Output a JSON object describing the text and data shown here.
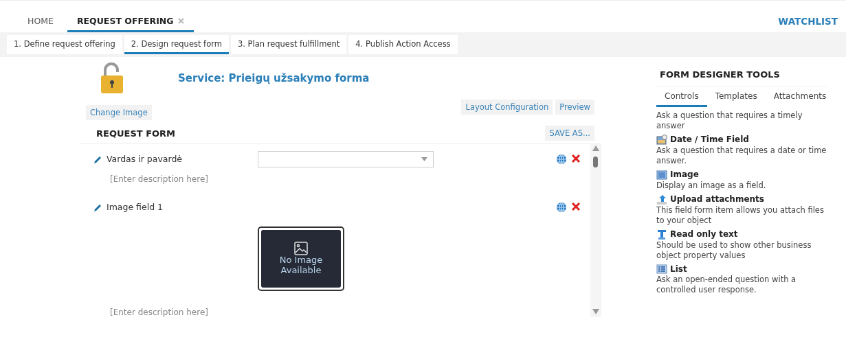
{
  "nav_tabs": [
    {
      "label": "HOME",
      "selected": false,
      "closable": false
    },
    {
      "label": "REQUEST OFFERING",
      "selected": true,
      "closable": true
    }
  ],
  "watchlist": "WATCHLIST",
  "steps": [
    {
      "label": "1. Define request offering",
      "selected": false
    },
    {
      "label": "2. Design request form",
      "selected": true
    },
    {
      "label": "3. Plan request fulfillment",
      "selected": false
    },
    {
      "label": "4. Publish Action Access",
      "selected": false
    }
  ],
  "service_title": "Service: Prieigų užsakymo forma",
  "change_image": "Change Image",
  "layout_configuration": "Layout Configuration",
  "preview": "Preview",
  "request_form": {
    "title": "REQUEST FORM",
    "save_as": "SAVE AS...",
    "fields": [
      {
        "kind": "dropdown",
        "label": "Vardas ir pavardė",
        "description": "[Enter description here]"
      },
      {
        "kind": "image",
        "label": "Image field 1",
        "image_text": "No Image Available",
        "description": "[Enter description here]"
      }
    ]
  },
  "tools": {
    "title": "FORM DESIGNER TOOLS",
    "tabs": [
      {
        "label": "Controls",
        "selected": true
      },
      {
        "label": "Templates",
        "selected": false
      },
      {
        "label": "Attachments",
        "selected": false
      }
    ],
    "items": [
      {
        "description": "Ask a question that requires a timely answer"
      },
      {
        "kind": "datetime",
        "name": "Date / Time Field",
        "description": "Ask a question that requires a date or time answer."
      },
      {
        "kind": "image",
        "name": "Image",
        "description": "Display an image as a field."
      },
      {
        "kind": "upload",
        "name": "Upload attachments",
        "description": "This field form item allows you attach files to your object"
      },
      {
        "kind": "readonly",
        "name": "Read only text",
        "description": "Should be used to show other business object property values"
      },
      {
        "kind": "list",
        "name": "List",
        "description": "Ask an open-ended question with a controlled user response."
      }
    ]
  }
}
